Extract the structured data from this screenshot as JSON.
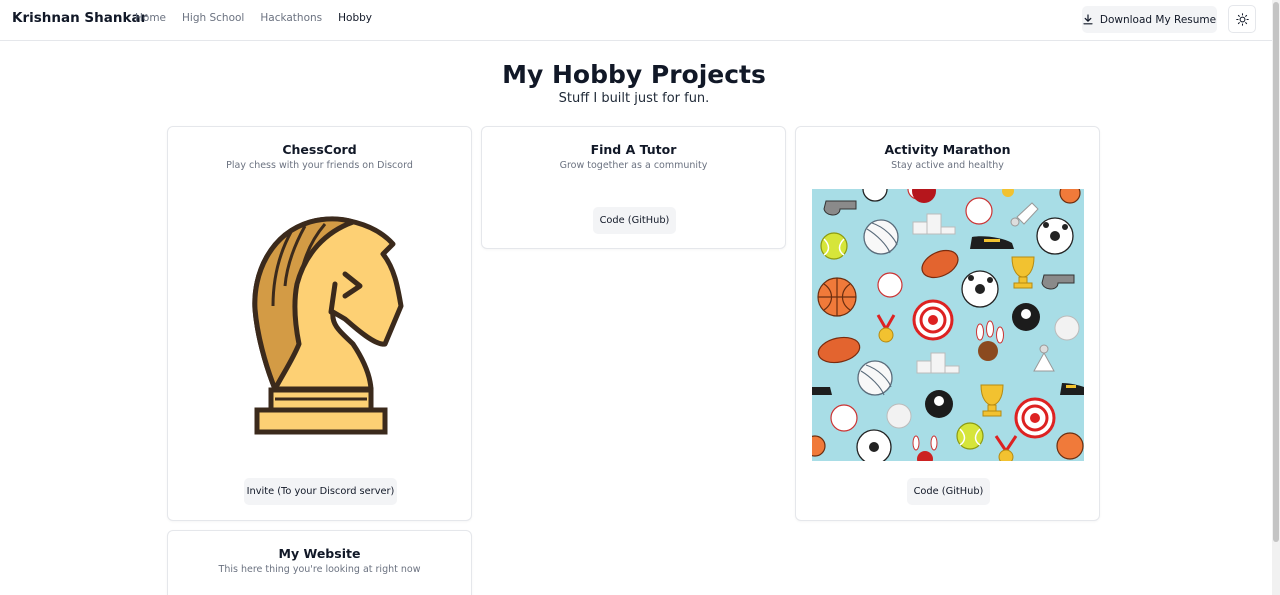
{
  "header": {
    "brand": "Krishnan Shankar",
    "nav": [
      {
        "label": "Home"
      },
      {
        "label": "High School"
      },
      {
        "label": "Hackathons"
      },
      {
        "label": "Hobby"
      }
    ],
    "resume_label": "Download My Resume",
    "download_icon": "download-icon",
    "theme_icon": "sun-icon"
  },
  "page": {
    "title": "My Hobby Projects",
    "subtitle": "Stuff I built just for fun."
  },
  "projects": [
    {
      "title": "ChessCord",
      "description": "Play chess with your friends on Discord",
      "button": "Invite (To your Discord server)",
      "image": "chess-knight-image"
    },
    {
      "title": "Find A Tutor",
      "description": "Grow together as a community",
      "button": "Code (GitHub)"
    },
    {
      "title": "Activity Marathon",
      "description": "Stay active and healthy",
      "button": "Code (GitHub)",
      "image": "sports-equipment-pattern-image"
    },
    {
      "title": "My Website",
      "description": "This here thing you're looking at right now"
    }
  ],
  "colors": {
    "knight_fill": "#fdd074",
    "knight_dark": "#d39b45",
    "knight_outline": "#3b2a1c",
    "sports_bg": "#a8dde6"
  }
}
